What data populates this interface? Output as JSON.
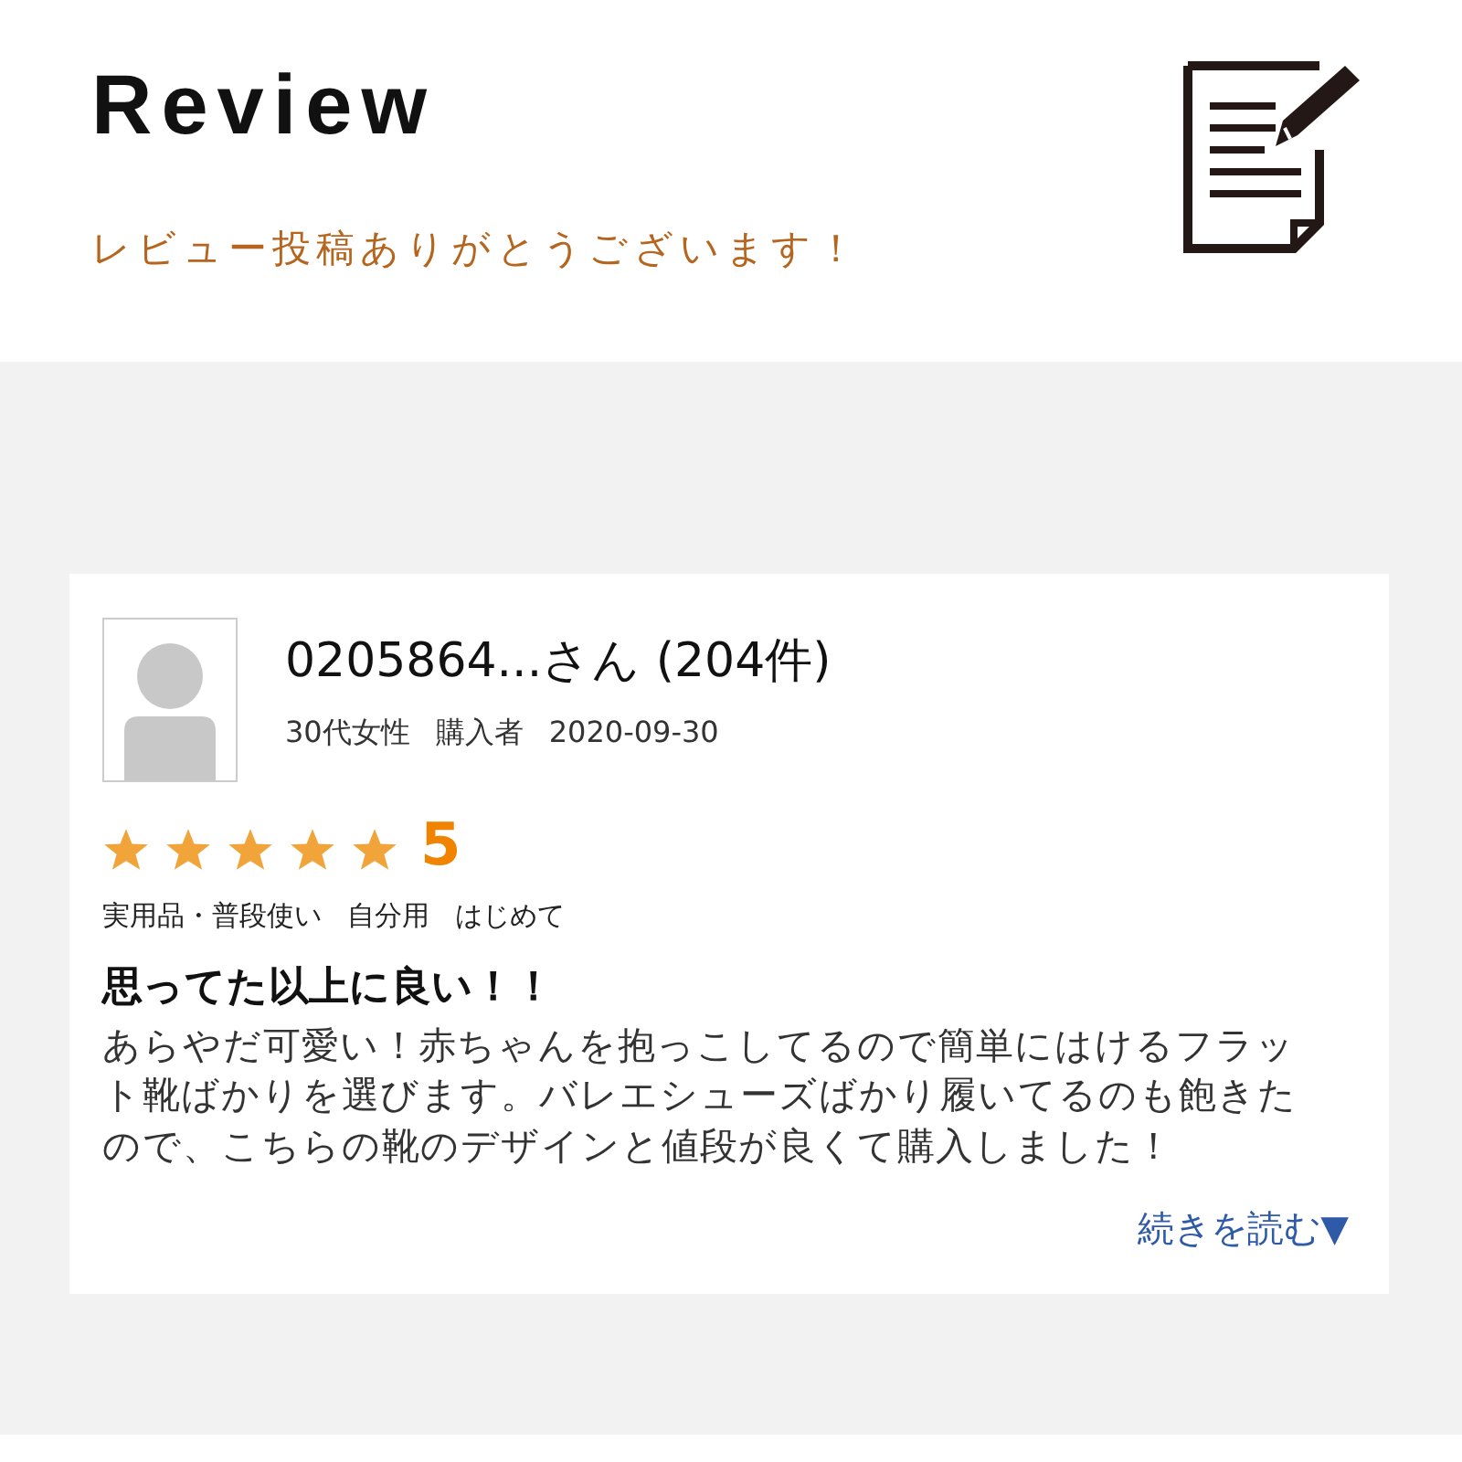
{
  "header": {
    "title": "Review",
    "subtitle": "レビュー投稿ありがとうございます！"
  },
  "review": {
    "reviewer": "0205864...さん (204件)",
    "meta": [
      "30代女性",
      "購入者",
      "2020-09-30"
    ],
    "stars": 5,
    "score": "5",
    "tags": [
      "実用品・普段使い",
      "自分用",
      "はじめて"
    ],
    "headline": "思ってた以上に良い！！",
    "body": "あらやだ可愛い！赤ちゃんを抱っこしてるので簡単にはけるフラット靴ばかりを選びます。バレエシューズばかり履いてるのも飽きたので、こちらの靴のデザインと値段が良くて購入しました！",
    "more_link": "続きを読む▼"
  }
}
